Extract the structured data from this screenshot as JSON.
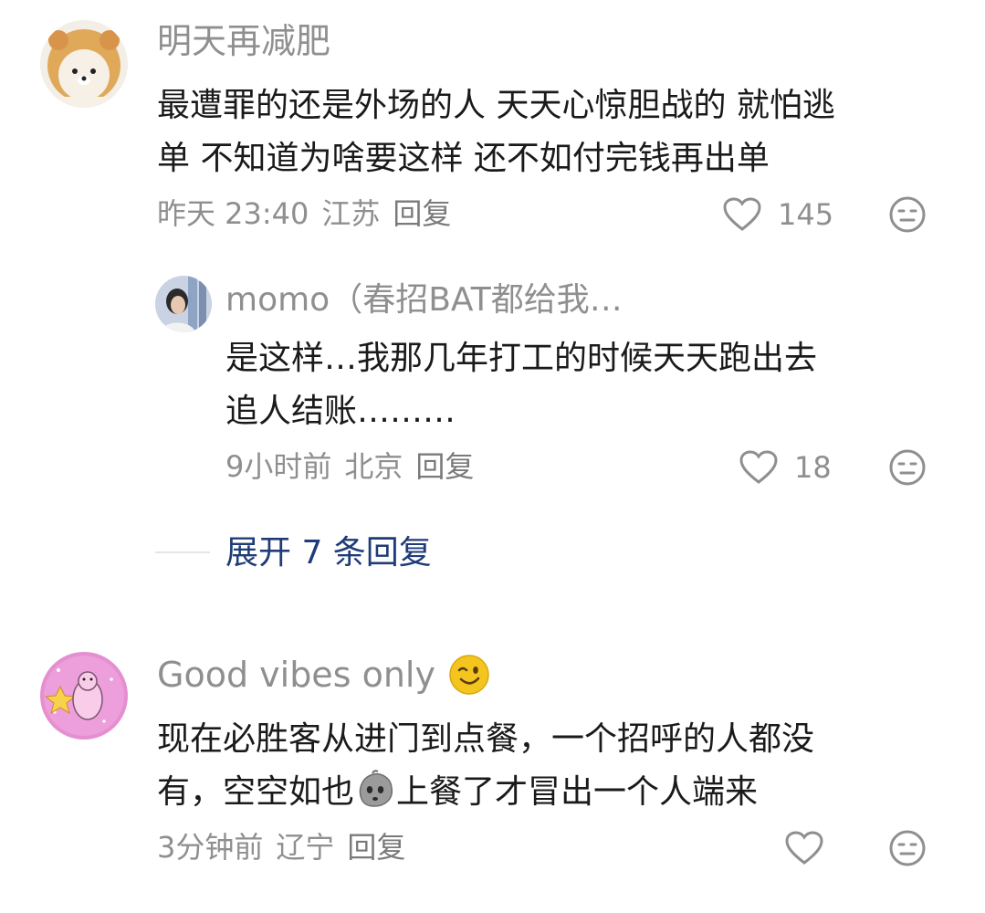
{
  "comments": [
    {
      "username": "明天再减肥",
      "text_lines": [
        "最遭罪的还是外场的人 天天心惊胆战的 就怕逃",
        "单 不知道为啥要这样 还不如付完钱再出单"
      ],
      "time": "昨天 23:40",
      "location": "江苏",
      "reply_label": "回复",
      "likes": "145",
      "avatar_icon": "bear-in-lion-hat-avatar"
    },
    {
      "username": "momo（春招BAT都给我…",
      "text_lines": [
        "是这样…我那几年打工的时候天天跑出去",
        "追人结账………"
      ],
      "time": "9小时前",
      "location": "北京",
      "reply_label": "回复",
      "likes": "18",
      "avatar_icon": "person-photo-avatar"
    },
    {
      "username": "Good vibes only",
      "username_emoji": "winking-face-icon",
      "text_line1": "现在必胜客从进门到点餐，一个招呼的人都没",
      "text_line2_a": "有，空空如也",
      "text_line2_b": "上餐了才冒出一个人端来",
      "inline_emoji": "sad-pebble-icon",
      "time": "3分钟前",
      "location": "辽宁",
      "reply_label": "回复",
      "likes": "",
      "avatar_icon": "pink-bear-sticker-avatar"
    }
  ],
  "expand_replies": "展开 7 条回复",
  "colors": {
    "meta_gray": "#8f8f8f",
    "link_blue": "#1f3c78",
    "text": "#1a1a1a"
  }
}
